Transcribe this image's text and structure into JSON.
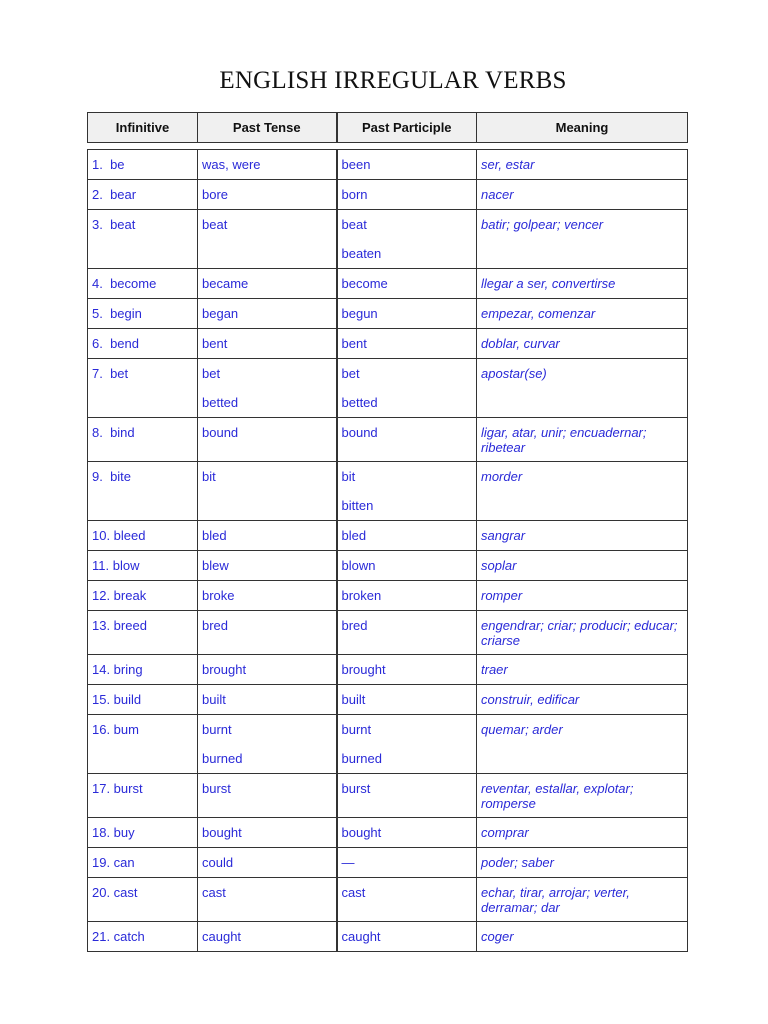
{
  "title": "ENGLISH IRREGULAR VERBS",
  "headers": [
    "Infinitive",
    "Past Tense",
    "Past Participle",
    "Meaning"
  ],
  "rows": [
    {
      "infinitive": "1.  be",
      "past": [
        "was, were"
      ],
      "participle": [
        "been"
      ],
      "meaning": "ser, estar"
    },
    {
      "infinitive": "2.  bear",
      "past": [
        "bore"
      ],
      "participle": [
        "born"
      ],
      "meaning": "nacer"
    },
    {
      "infinitive": "3.  beat",
      "past": [
        "beat"
      ],
      "participle": [
        "beat",
        "beaten"
      ],
      "meaning": "batir; golpear; vencer"
    },
    {
      "infinitive": "4.  become",
      "past": [
        "became"
      ],
      "participle": [
        "become"
      ],
      "meaning": "llegar a ser, convertirse"
    },
    {
      "infinitive": "5.  begin",
      "past": [
        "began"
      ],
      "participle": [
        "begun"
      ],
      "meaning": "empezar, comenzar"
    },
    {
      "infinitive": "6.  bend",
      "past": [
        "bent"
      ],
      "participle": [
        "bent"
      ],
      "meaning": "doblar, curvar"
    },
    {
      "infinitive": "7.  bet",
      "past": [
        "bet",
        "betted"
      ],
      "participle": [
        "bet",
        "betted"
      ],
      "meaning": "apostar(se)"
    },
    {
      "infinitive": "8.  bind",
      "past": [
        "bound"
      ],
      "participle": [
        "bound"
      ],
      "meaning": "ligar, atar, unir; encuadernar; ribetear"
    },
    {
      "infinitive": "9.  bite",
      "past": [
        "bit"
      ],
      "participle": [
        "bit",
        "bitten"
      ],
      "meaning": "morder"
    },
    {
      "infinitive": "10. bleed",
      "past": [
        "bled"
      ],
      "participle": [
        "bled"
      ],
      "meaning": "sangrar"
    },
    {
      "infinitive": "11. blow",
      "past": [
        "blew"
      ],
      "participle": [
        "blown"
      ],
      "meaning": "soplar"
    },
    {
      "infinitive": "12. break",
      "past": [
        "broke"
      ],
      "participle": [
        "broken"
      ],
      "meaning": "romper"
    },
    {
      "infinitive": "13. breed",
      "past": [
        "bred"
      ],
      "participle": [
        "bred"
      ],
      "meaning": "engendrar; criar; producir; educar; criarse"
    },
    {
      "infinitive": "14. bring",
      "past": [
        "brought"
      ],
      "participle": [
        "brought"
      ],
      "meaning": "traer"
    },
    {
      "infinitive": "15. build",
      "past": [
        "built"
      ],
      "participle": [
        "built"
      ],
      "meaning": "construir, edificar"
    },
    {
      "infinitive": "16. bum",
      "past": [
        "burnt",
        "burned"
      ],
      "participle": [
        "burnt",
        "burned"
      ],
      "meaning": "quemar; arder"
    },
    {
      "infinitive": "17. burst",
      "past": [
        "burst"
      ],
      "participle": [
        "burst"
      ],
      "meaning": "reventar, estallar, explotar; romperse"
    },
    {
      "infinitive": "18. buy",
      "past": [
        "bought"
      ],
      "participle": [
        "bought"
      ],
      "meaning": "comprar"
    },
    {
      "infinitive": "19. can",
      "past": [
        "could"
      ],
      "participle": [
        "—"
      ],
      "meaning": "poder; saber"
    },
    {
      "infinitive": "20. cast",
      "past": [
        "cast"
      ],
      "participle": [
        "cast"
      ],
      "meaning": "echar, tirar, arrojar; verter, derramar; dar"
    },
    {
      "infinitive": "21. catch",
      "past": [
        "caught"
      ],
      "participle": [
        "caught"
      ],
      "meaning": "coger"
    }
  ]
}
